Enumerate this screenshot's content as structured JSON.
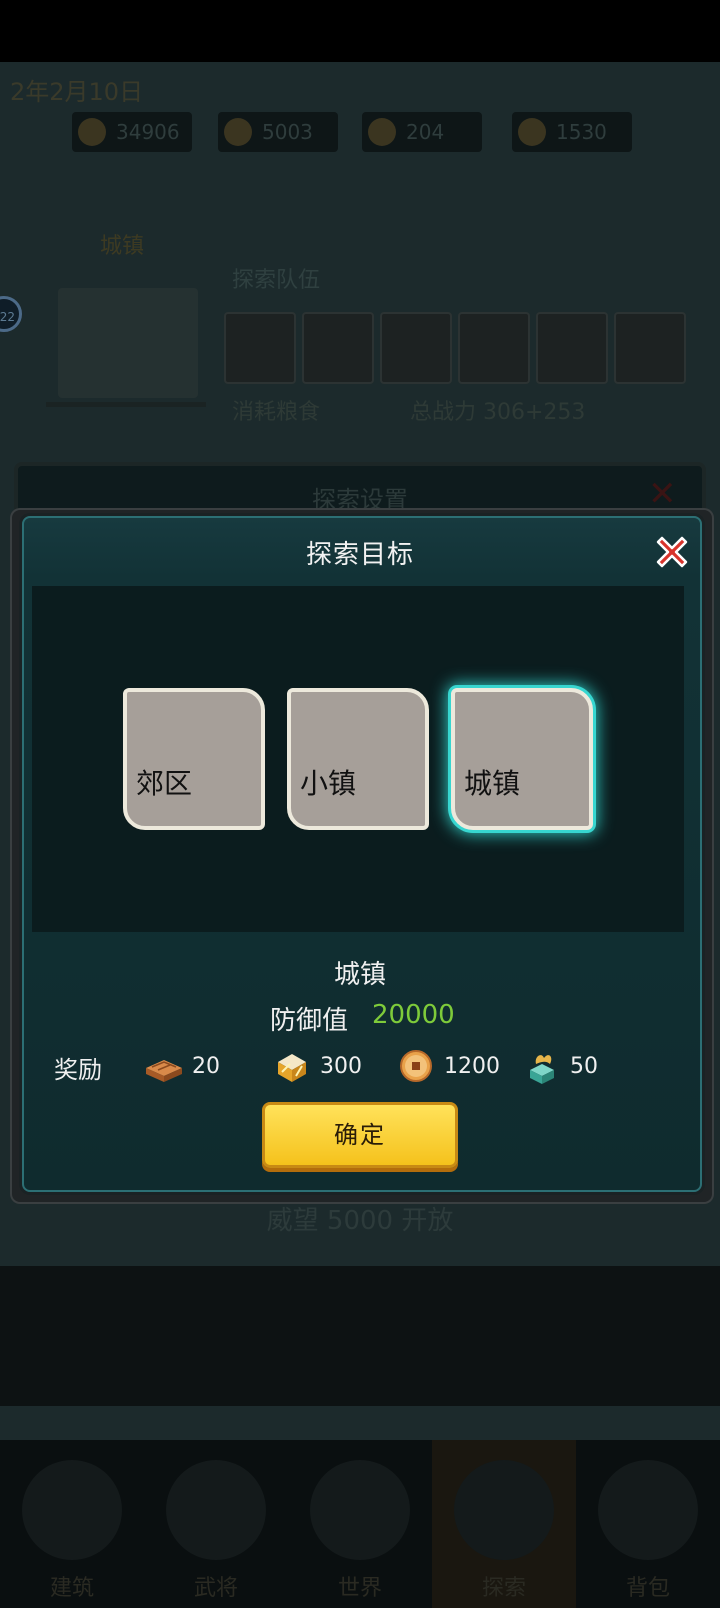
{
  "background": {
    "date": "2年2月10日",
    "resources": [
      "34906",
      "5003",
      "204",
      "1530"
    ],
    "city_label": "城镇",
    "team_label": "探索队伍",
    "cost_label": "消耗粮食",
    "power_label": "总战力 306+253",
    "side_badge": "22",
    "back_modal_title": "探索设置",
    "prestige_notice": "威望 5000 开放",
    "nav": [
      "建筑",
      "武将",
      "世界",
      "探索",
      "背包"
    ]
  },
  "dialog": {
    "title": "探索目标",
    "targets": [
      {
        "label": "郊区"
      },
      {
        "label": "小镇"
      },
      {
        "label": "城镇"
      }
    ],
    "selected_index": 2,
    "selected_name": "城镇",
    "defense_label": "防御值",
    "defense_value": "20000",
    "reward_label": "奖励",
    "rewards": [
      {
        "icon": "brick-icon",
        "value": "20"
      },
      {
        "icon": "food-crate-icon",
        "value": "300"
      },
      {
        "icon": "copper-coin-icon",
        "value": "1200"
      },
      {
        "icon": "jade-treasure-icon",
        "value": "50"
      }
    ],
    "confirm_label": "确定"
  },
  "colors": {
    "defense_value": "#7ecb3a",
    "confirm_button": "#f5c21c",
    "selected_glow": "#37d6d0",
    "close_red": "#d8342c"
  }
}
